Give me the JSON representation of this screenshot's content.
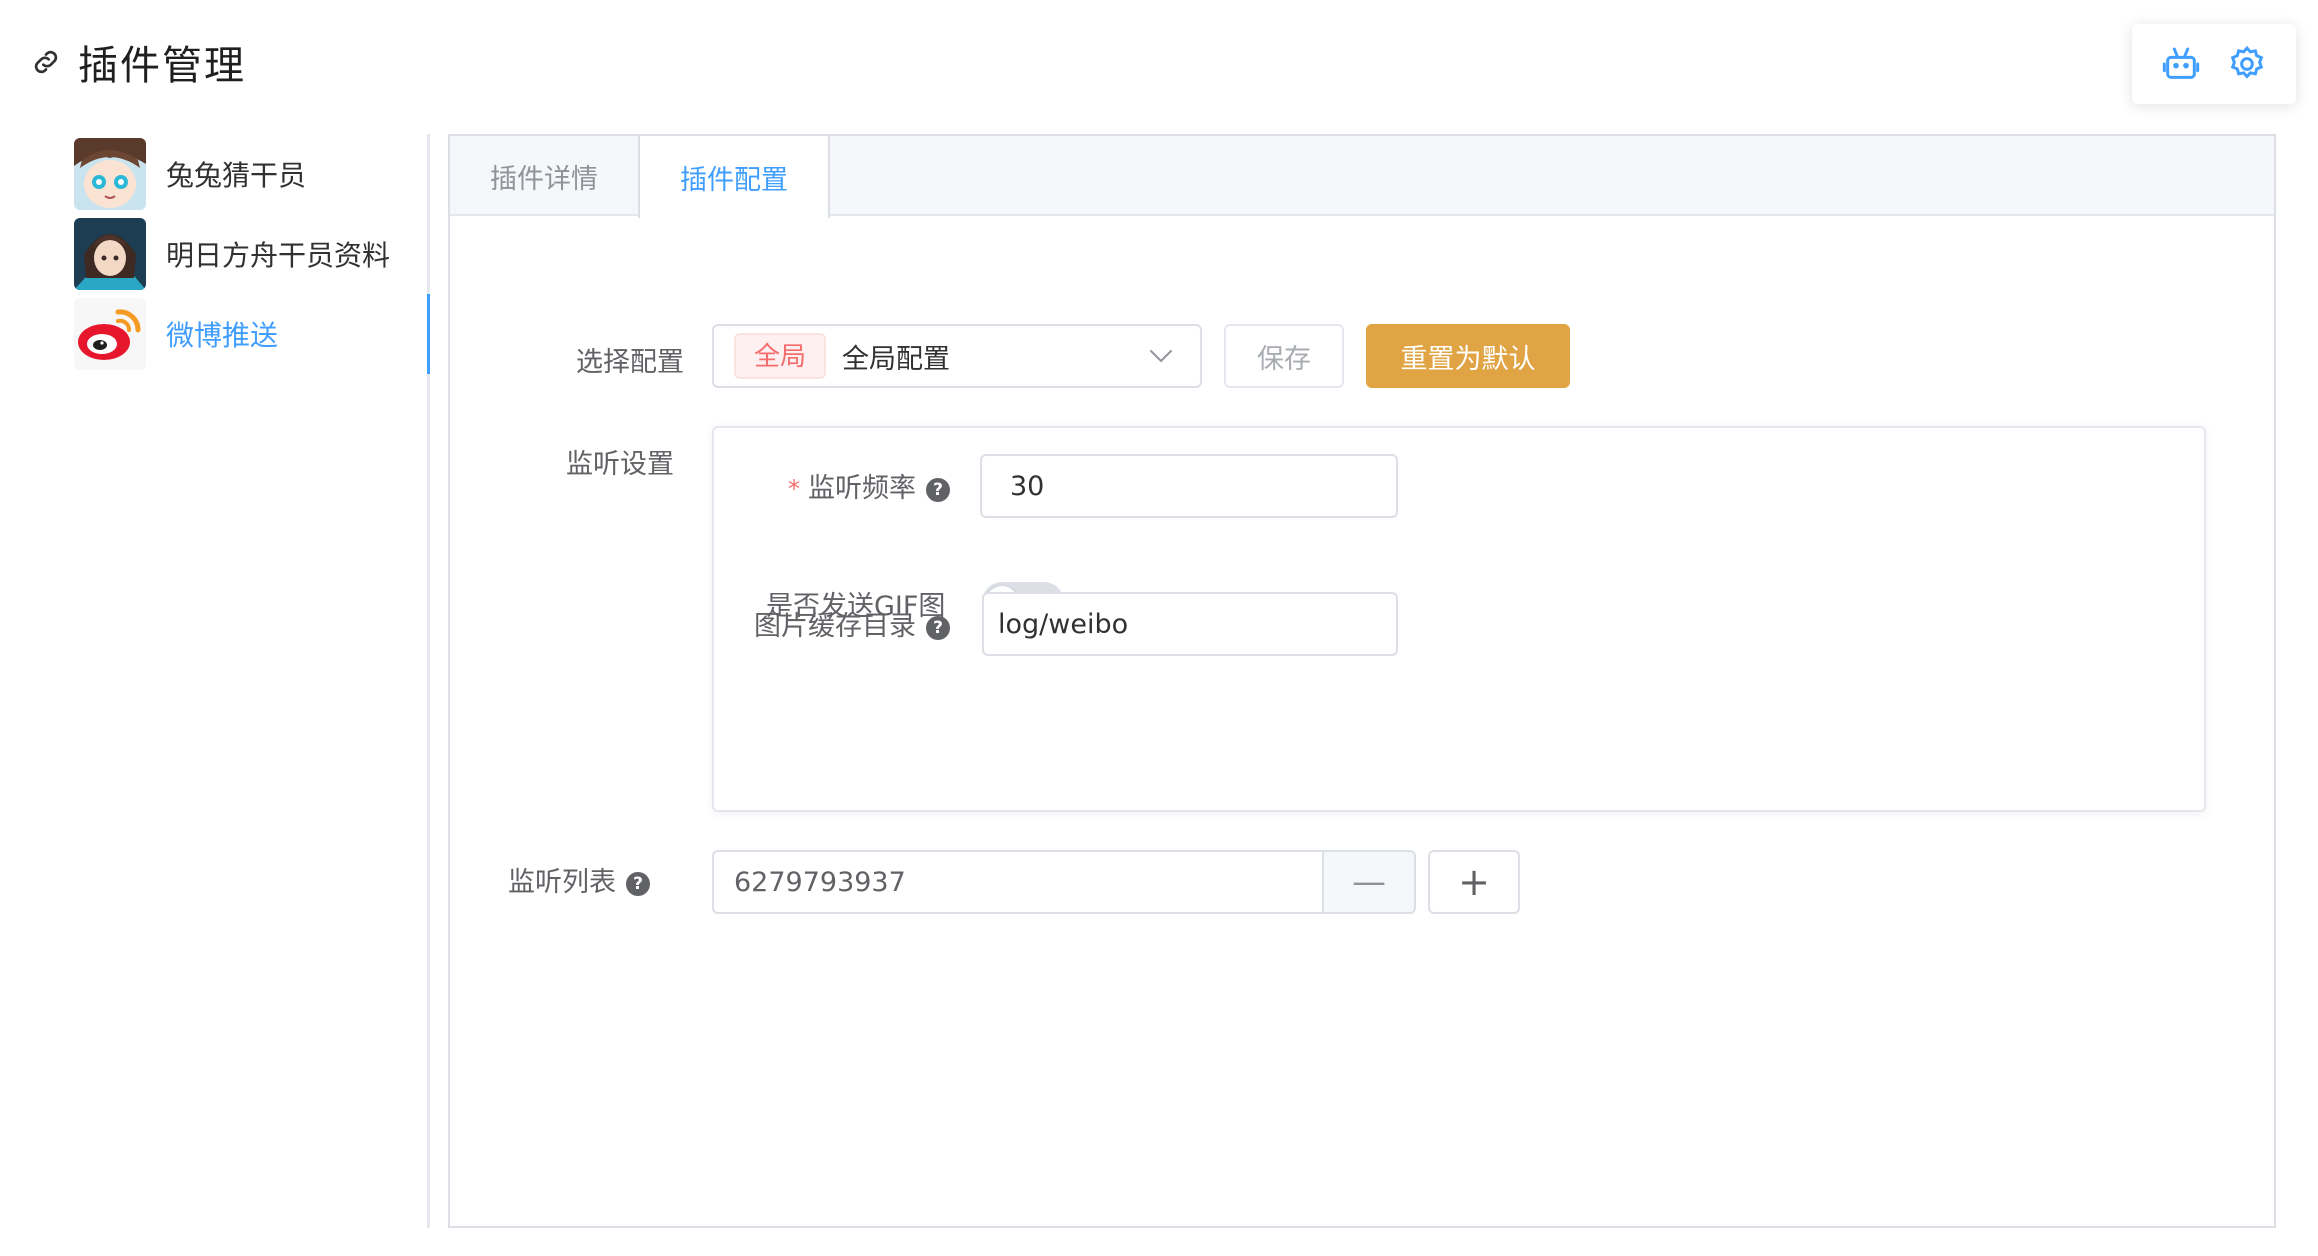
{
  "header": {
    "title": "插件管理",
    "icons": [
      "link-icon"
    ]
  },
  "top_actions": {
    "icons": [
      "robot-icon",
      "gear-icon"
    ],
    "accent": "#409eff"
  },
  "sidebar": {
    "items": [
      {
        "name": "兔兔猜干员",
        "active": false
      },
      {
        "name": "明日方舟干员资料",
        "active": false
      },
      {
        "name": "微博推送",
        "active": true
      }
    ]
  },
  "tabs": [
    {
      "label": "插件详情",
      "active": false
    },
    {
      "label": "插件配置",
      "active": true
    }
  ],
  "config": {
    "select_label": "选择配置",
    "select_tag": "全局",
    "select_value": "全局配置",
    "save_label": "保存",
    "reset_label": "重置为默认",
    "reset_color": "#e1a444",
    "monitor_settings_label": "监听设置",
    "frequency": {
      "label": "监听频率",
      "value": "30",
      "required": true
    },
    "send_gif": {
      "label": "是否发送GIF图",
      "enabled": false
    },
    "cache_dir": {
      "label": "图片缓存目录",
      "value": "log/weibo"
    },
    "monitor_list": {
      "label": "监听列表",
      "values": [
        "6279793937"
      ],
      "minus": "—",
      "plus": "+"
    }
  }
}
